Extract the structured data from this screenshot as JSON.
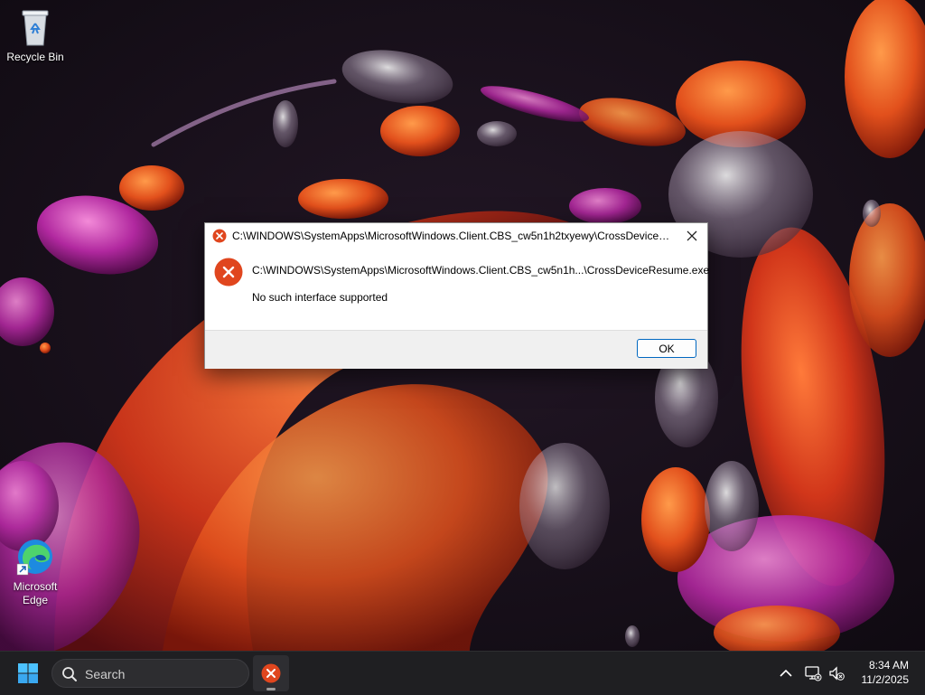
{
  "desktop": {
    "icons": [
      {
        "label": "Recycle Bin",
        "icon": "recycle-bin-icon"
      },
      {
        "label": "Microsoft Edge",
        "icon": "edge-icon"
      }
    ]
  },
  "dialog": {
    "title": "C:\\WINDOWS\\SystemApps\\MicrosoftWindows.Client.CBS_cw5n1h2txyewy\\CrossDeviceResu...",
    "path": "C:\\WINDOWS\\SystemApps\\MicrosoftWindows.Client.CBS_cw5n1h...\\CrossDeviceResume.exe",
    "message": "No such interface supported",
    "ok_label": "OK",
    "icon": "error-icon",
    "close_icon": "close-icon"
  },
  "taskbar": {
    "search_placeholder": "Search",
    "start_icon": "windows-start-icon",
    "active_app_icon": "error-icon",
    "tray_icons": [
      "chevron-up-icon",
      "network-icon",
      "volume-muted-icon"
    ],
    "time": "8:34 AM",
    "date": "11/2/2025"
  },
  "colors": {
    "error_red": "#e0461e",
    "accent_blue": "#0067c0",
    "taskbar_bg": "#1f1f22"
  }
}
